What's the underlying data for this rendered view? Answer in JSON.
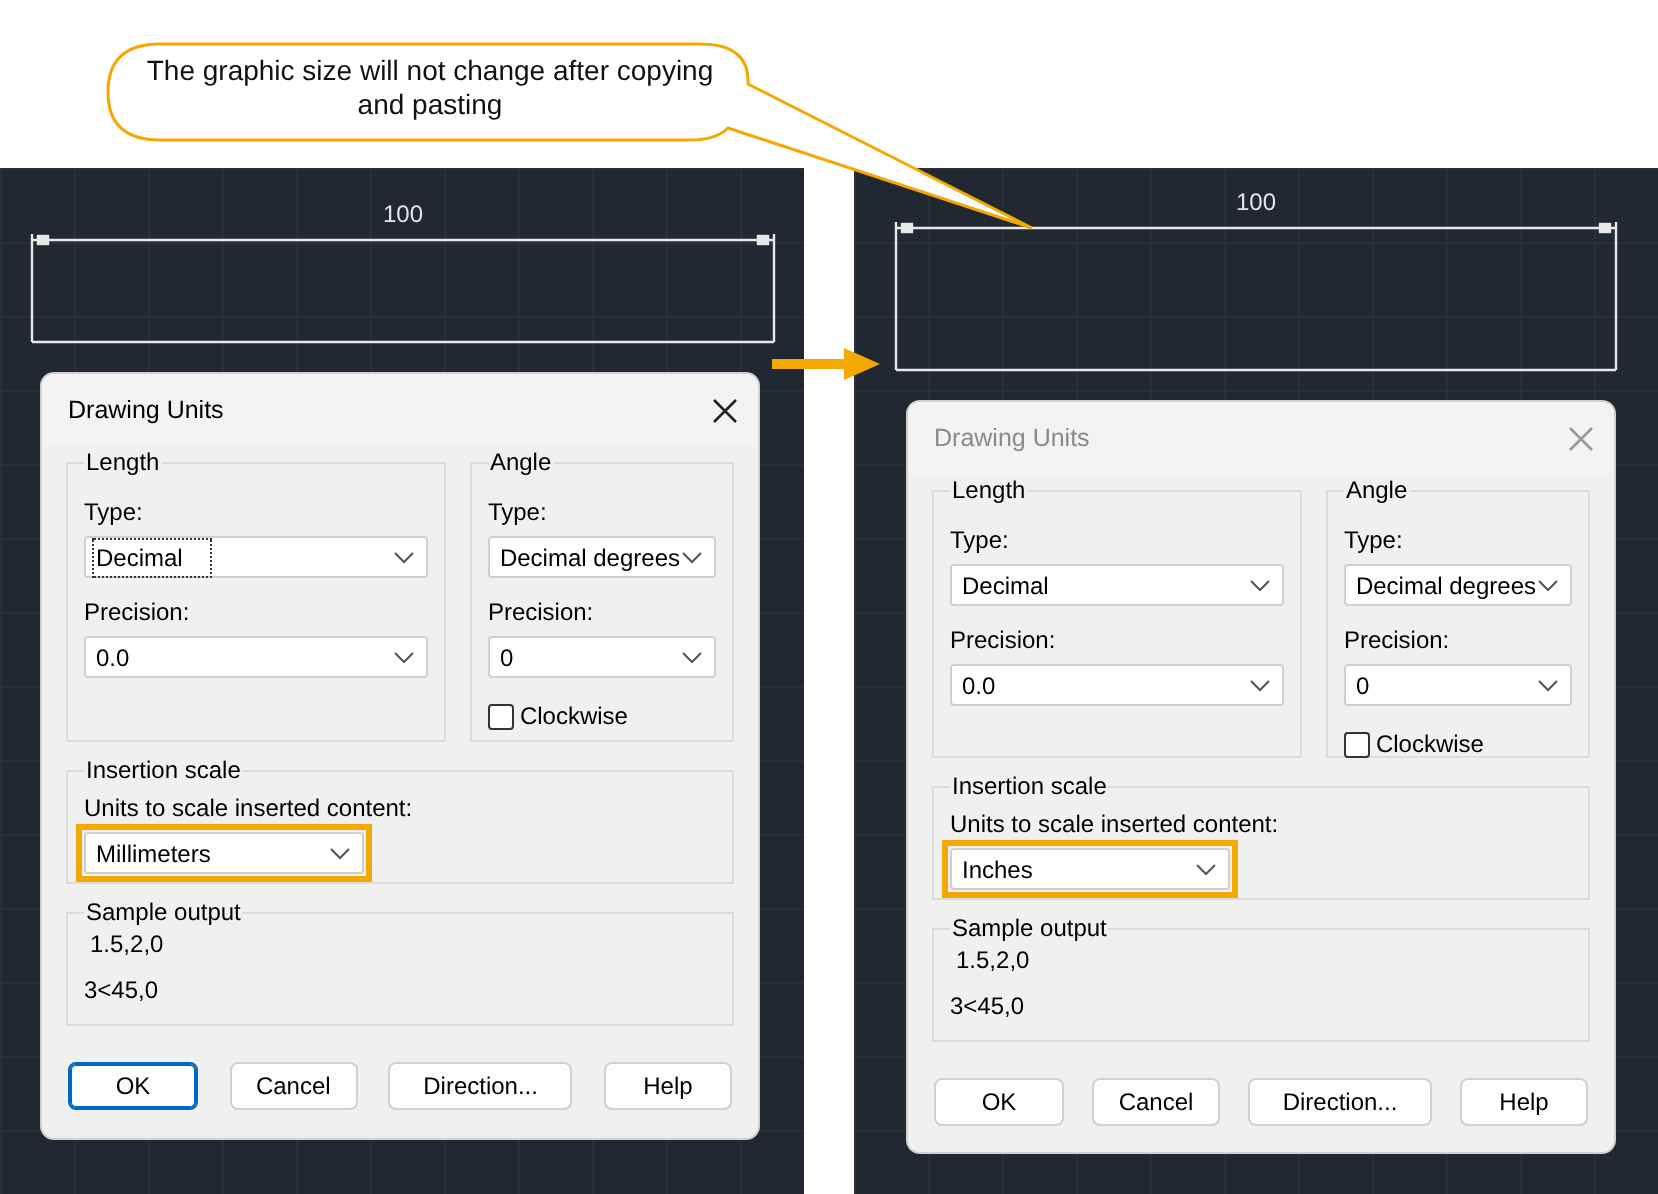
{
  "callout": {
    "text": "The graphic size will not change after copying and pasting"
  },
  "panels": [
    {
      "dimension": {
        "text": "100"
      },
      "dialog": {
        "title": "Drawing Units",
        "active": true,
        "length": {
          "label": "Length",
          "type_label": "Type:",
          "type_value": "Decimal",
          "type_focused": true,
          "precision_label": "Precision:",
          "precision_value": "0.0"
        },
        "angle": {
          "label": "Angle",
          "type_label": "Type:",
          "type_value": "Decimal degrees",
          "precision_label": "Precision:",
          "precision_value": "0",
          "clockwise_label": "Clockwise",
          "clockwise_checked": false
        },
        "insertion": {
          "label": "Insertion scale",
          "units_label": "Units to scale inserted content:",
          "units_value": "Millimeters",
          "highlighted": true
        },
        "sample": {
          "label": "Sample output",
          "lines": [
            "1.5,2,0",
            "3<45,0"
          ]
        },
        "buttons": [
          {
            "label": "OK",
            "default": true
          },
          {
            "label": "Cancel",
            "default": false
          },
          {
            "label": "Direction...",
            "default": false
          },
          {
            "label": "Help",
            "default": false
          }
        ]
      }
    },
    {
      "dimension": {
        "text": "100"
      },
      "dialog": {
        "title": "Drawing Units",
        "active": false,
        "length": {
          "label": "Length",
          "type_label": "Type:",
          "type_value": "Decimal",
          "type_focused": false,
          "precision_label": "Precision:",
          "precision_value": "0.0"
        },
        "angle": {
          "label": "Angle",
          "type_label": "Type:",
          "type_value": "Decimal degrees",
          "precision_label": "Precision:",
          "precision_value": "0",
          "clockwise_label": "Clockwise",
          "clockwise_checked": false
        },
        "insertion": {
          "label": "Insertion scale",
          "units_label": "Units to scale inserted content:",
          "units_value": "Inches",
          "highlighted": true
        },
        "sample": {
          "label": "Sample output",
          "lines": [
            "1.5,2,0",
            "3<45,0"
          ]
        },
        "buttons": [
          {
            "label": "OK",
            "default": false
          },
          {
            "label": "Cancel",
            "default": false
          },
          {
            "label": "Direction...",
            "default": false
          },
          {
            "label": "Help",
            "default": false
          }
        ]
      }
    }
  ]
}
